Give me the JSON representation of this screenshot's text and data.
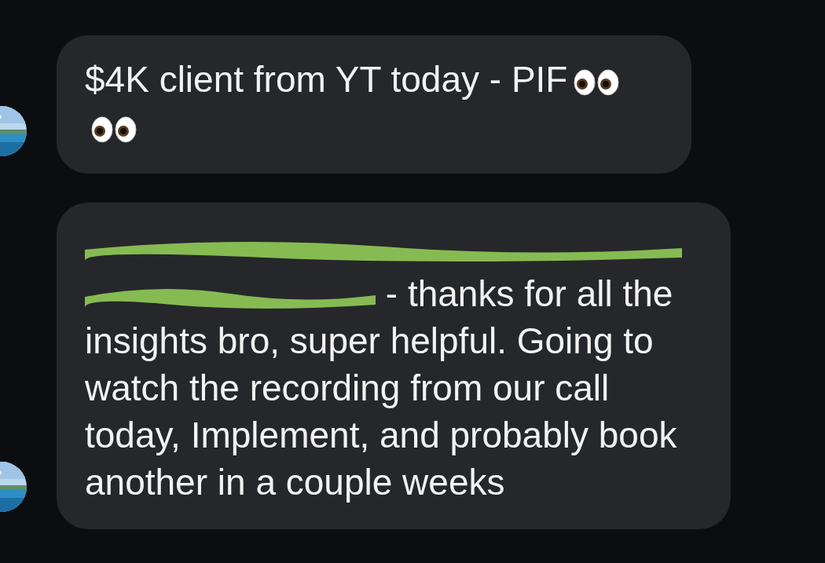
{
  "messages": [
    {
      "kind": "emoji",
      "text": "$4K client from YT today - PIF",
      "avatar": true
    },
    {
      "kind": "redacted",
      "text_start": "- thanks for all the",
      "text": "insights bro, super helpful. Going to watch the recording from our call today, Implement, and probably book another in a couple weeks",
      "avatar": true
    }
  ]
}
